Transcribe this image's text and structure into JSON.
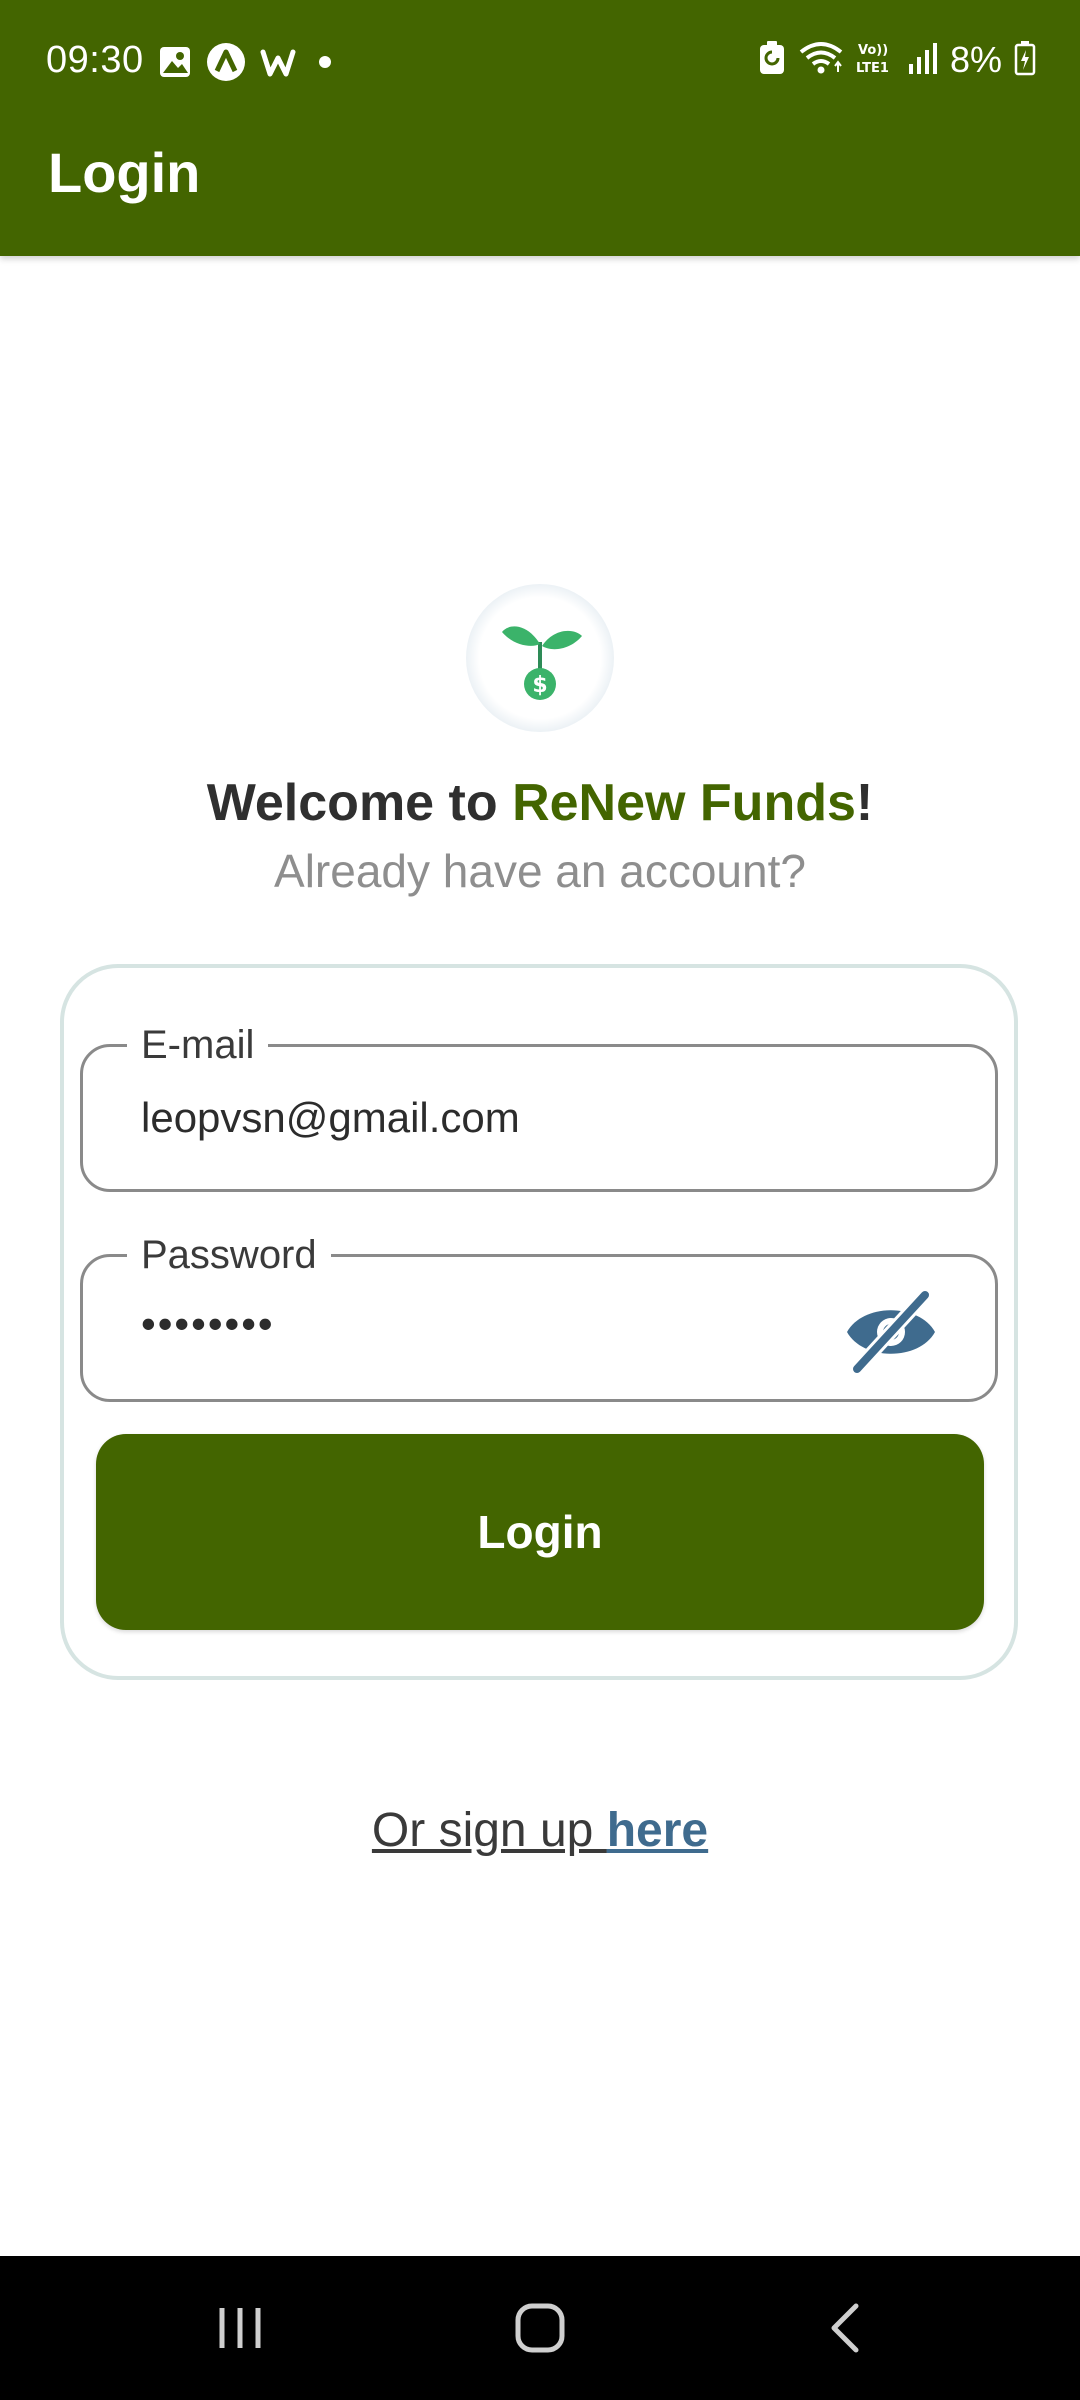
{
  "status_bar": {
    "time": "09:30",
    "battery_percent": "8%",
    "left_icons": [
      "image-icon",
      "a-icon",
      "w-icon",
      "dot-icon"
    ],
    "right_icons": [
      "battery-saver-icon",
      "wifi-icon",
      "volte-icon",
      "signal-icon",
      "battery-icon"
    ]
  },
  "app_bar": {
    "title": "Login"
  },
  "header": {
    "welcome_prefix": "Welcome to ",
    "brand": "ReNew Funds",
    "welcome_suffix": "!",
    "subtitle": "Already have an account?"
  },
  "form": {
    "email": {
      "label": "E-mail",
      "value": "leopvsn@gmail.com"
    },
    "password": {
      "label": "Password",
      "value": "••••••••"
    },
    "login_button": "Login"
  },
  "signup": {
    "prefix": "Or sign up ",
    "link": "here"
  },
  "colors": {
    "primary": "#436500",
    "accent_blue": "#3f6b8e",
    "logo_green": "#3bb36a"
  }
}
